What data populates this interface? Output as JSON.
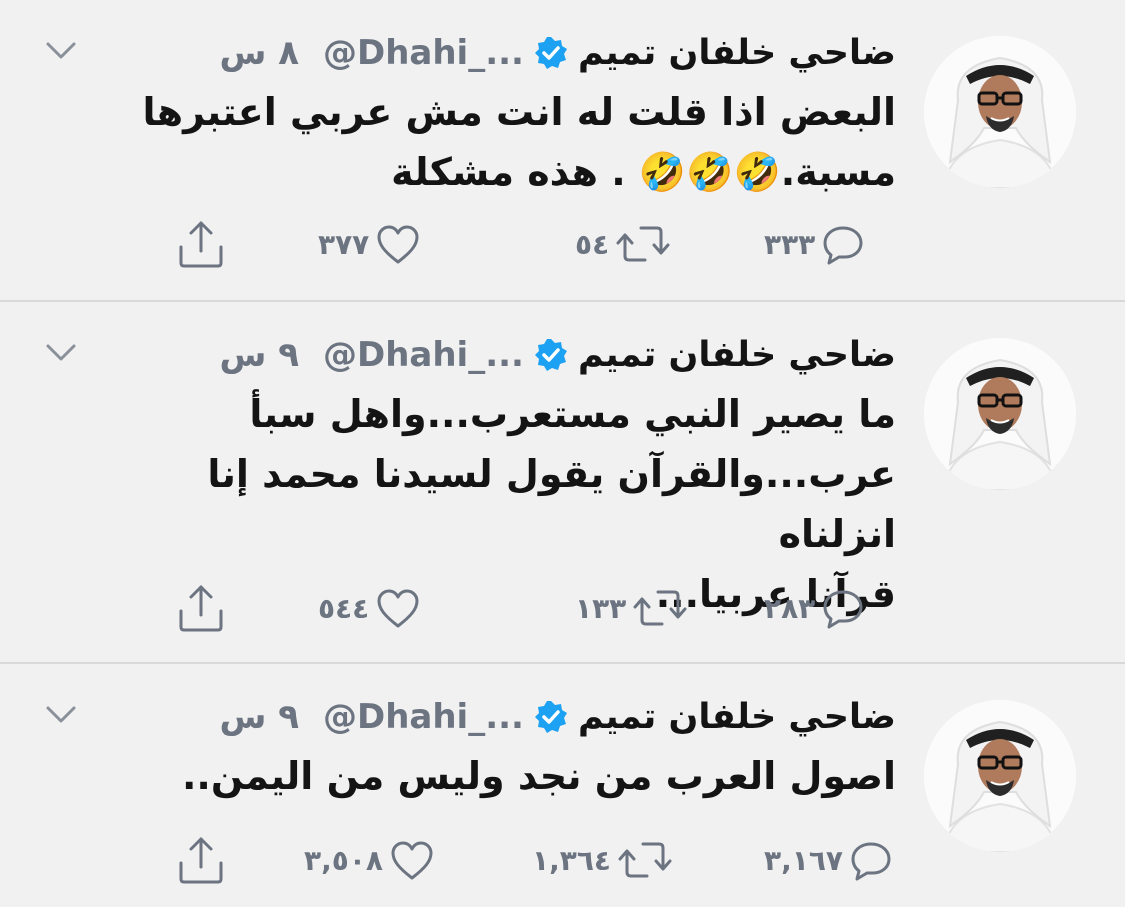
{
  "colors": {
    "background": "#f1f1f1",
    "text": "#141414",
    "muted": "#6b7480",
    "verified": "#1da1f2",
    "divider": "#d9d9d9"
  },
  "tweets": [
    {
      "name": "ضاحي خلفان تميم",
      "handle": "@Dhahi_...",
      "time": "٨ س",
      "lines": [
        "البعض اذا قلت له انت مش عربي اعتبرها",
        "مسبة.🤣🤣🤣 . هذه مشكلة"
      ],
      "replies": "٣٣٣",
      "retweets": "٥٤",
      "likes": "٣٧٧"
    },
    {
      "name": "ضاحي خلفان تميم",
      "handle": "@Dhahi_...",
      "time": "٩ س",
      "lines": [
        "ما يصير النبي مستعرب...واهل سبأ",
        "عرب...والقرآن يقول لسيدنا محمد إنا انزلناه",
        "قرآنا عربيا..."
      ],
      "replies": "٢٨٣",
      "retweets": "١٣٣",
      "likes": "٥٤٤"
    },
    {
      "name": "ضاحي خلفان تميم",
      "handle": "@Dhahi_...",
      "time": "٩ س",
      "lines": [
        "اصول العرب من نجد وليس من اليمن.."
      ],
      "replies": "٣,١٦٧",
      "retweets": "١,٣٦٤",
      "likes": "٣,٥٠٨"
    }
  ],
  "icons": {
    "reply": "reply-icon",
    "retweet": "retweet-icon",
    "like": "heart-icon",
    "share": "share-icon",
    "caret": "chevron-down-icon",
    "verified": "verified-badge-icon"
  }
}
